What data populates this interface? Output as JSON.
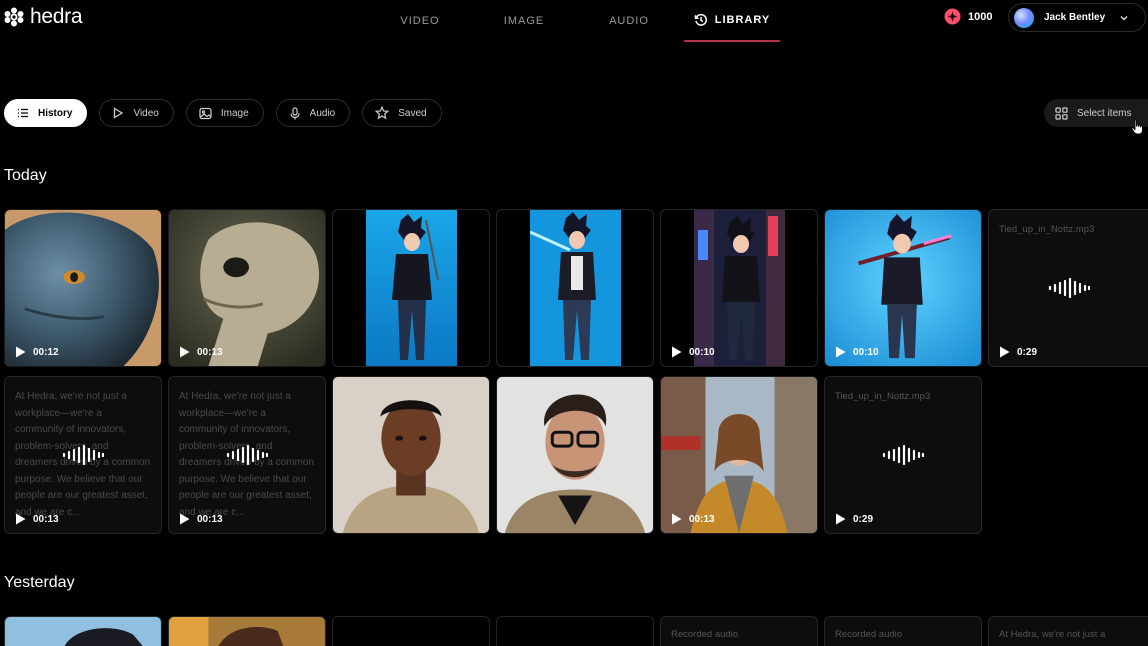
{
  "brand": {
    "name": "hedra"
  },
  "nav": [
    {
      "label": "VIDEO",
      "active": false
    },
    {
      "label": "IMAGE",
      "active": false
    },
    {
      "label": "AUDIO",
      "active": false
    },
    {
      "label": "LIBRARY",
      "active": true
    }
  ],
  "credits": {
    "count": "1000"
  },
  "user": {
    "name": "Jack Bentley"
  },
  "filters": [
    {
      "label": "History",
      "icon": "list-icon",
      "active": true
    },
    {
      "label": "Video",
      "icon": "play-icon",
      "active": false
    },
    {
      "label": "Image",
      "icon": "image-icon",
      "active": false
    },
    {
      "label": "Audio",
      "icon": "mic-icon",
      "active": false
    },
    {
      "label": "Saved",
      "icon": "star-icon",
      "active": false
    }
  ],
  "select_items": {
    "label": "Select items"
  },
  "sections": {
    "today": {
      "title": "Today"
    },
    "yesterday": {
      "title": "Yesterday"
    }
  },
  "cards": {
    "blue_alien": {
      "duration": "00:12"
    },
    "beige_alien": {
      "duration": "00:13"
    },
    "anime_neon_city": {
      "duration": "00:10"
    },
    "anime_blue_bg": {
      "duration": "00:10"
    },
    "audio_1": {
      "filename": "Tied_up_in_Nottz.mp3",
      "duration": "0:29"
    },
    "text_1": {
      "text": "At Hedra, we're not just a workplace—we're a community of innovators, problem-solvers, and dreamers driven by a common purpose. We believe that our people are our greatest asset, and we are c...",
      "duration": "00:13"
    },
    "text_2": {
      "text": "At Hedra, we're not just a workplace—we're a community of innovators, problem-solvers, and dreamers driven by a common purpose. We believe that our people are our greatest asset, and we are c...",
      "duration": "00:13"
    },
    "woman_street": {
      "duration": "00:13"
    },
    "audio_2": {
      "filename": "Tied_up_in_Nottz.mp3",
      "duration": "0:29"
    },
    "y_recorded_1": {
      "label": "Recorded audio"
    },
    "y_recorded_2": {
      "label": "Recorded audio"
    },
    "y_text": {
      "text": "At Hedra, we're not just a"
    }
  },
  "colors": {
    "accent": "#b53049",
    "credit_icon": "#ff4d6d",
    "background": "#000000"
  }
}
